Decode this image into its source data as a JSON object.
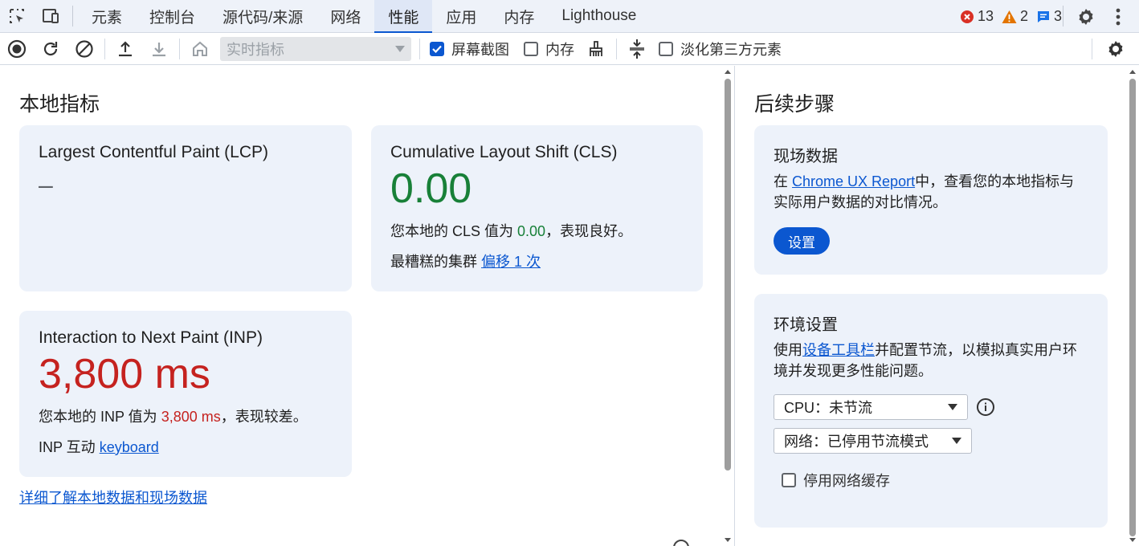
{
  "tabbar": {
    "tabs": [
      "元素",
      "控制台",
      "源代码/来源",
      "网络",
      "性能",
      "应用",
      "内存",
      "Lighthouse"
    ],
    "active_tab": "性能",
    "errors": "13",
    "warnings": "2",
    "messages": "3"
  },
  "toolbar": {
    "mode_select": "实时指标",
    "screenshots_label": "屏幕截图",
    "screenshots_checked": true,
    "memory_label": "内存",
    "memory_checked": false,
    "dim_third_party_label": "淡化第三方元素",
    "dim_third_party_checked": false
  },
  "local_metrics": {
    "heading": "本地指标",
    "lcp": {
      "title": "Largest Contentful Paint (LCP)",
      "value": "–"
    },
    "cls": {
      "title": "Cumulative Layout Shift (CLS)",
      "value": "0.00",
      "desc_prefix": "您本地的 CLS 值为 ",
      "desc_value": "0.00",
      "desc_suffix": "，表现良好。",
      "cluster_label": "最糟糕的集群 ",
      "cluster_link": "偏移 1 次"
    },
    "inp": {
      "title": "Interaction to Next Paint (INP)",
      "value": "3,800 ms",
      "desc_prefix": "您本地的 INP 值为 ",
      "desc_value": "3,800 ms",
      "desc_suffix": "，表现较差。",
      "interaction_label": "INP 互动 ",
      "interaction_link": "keyboard"
    },
    "learn_more_link": "详细了解本地数据和现场数据"
  },
  "next_steps": {
    "heading": "后续步骤",
    "field_data": {
      "title": "现场数据",
      "text_prefix": "在 ",
      "link": "Chrome UX Report",
      "text_suffix": "中，查看您的本地指标与实际用户数据的对比情况。",
      "button": "设置"
    },
    "environment": {
      "title": "环境设置",
      "text_prefix": "使用",
      "link": "设备工具栏",
      "text_suffix": "并配置节流，以模拟真实用户环境并发现更多性能问题。",
      "cpu_select": "CPU：未节流",
      "network_select": "网络：已停用节流模式",
      "disable_cache_label": "停用网络缓存",
      "disable_cache_checked": false
    }
  },
  "colors": {
    "accent": "#0b57d0",
    "good": "#188038",
    "bad": "#c5221f",
    "card_bg": "#edf2fa"
  }
}
